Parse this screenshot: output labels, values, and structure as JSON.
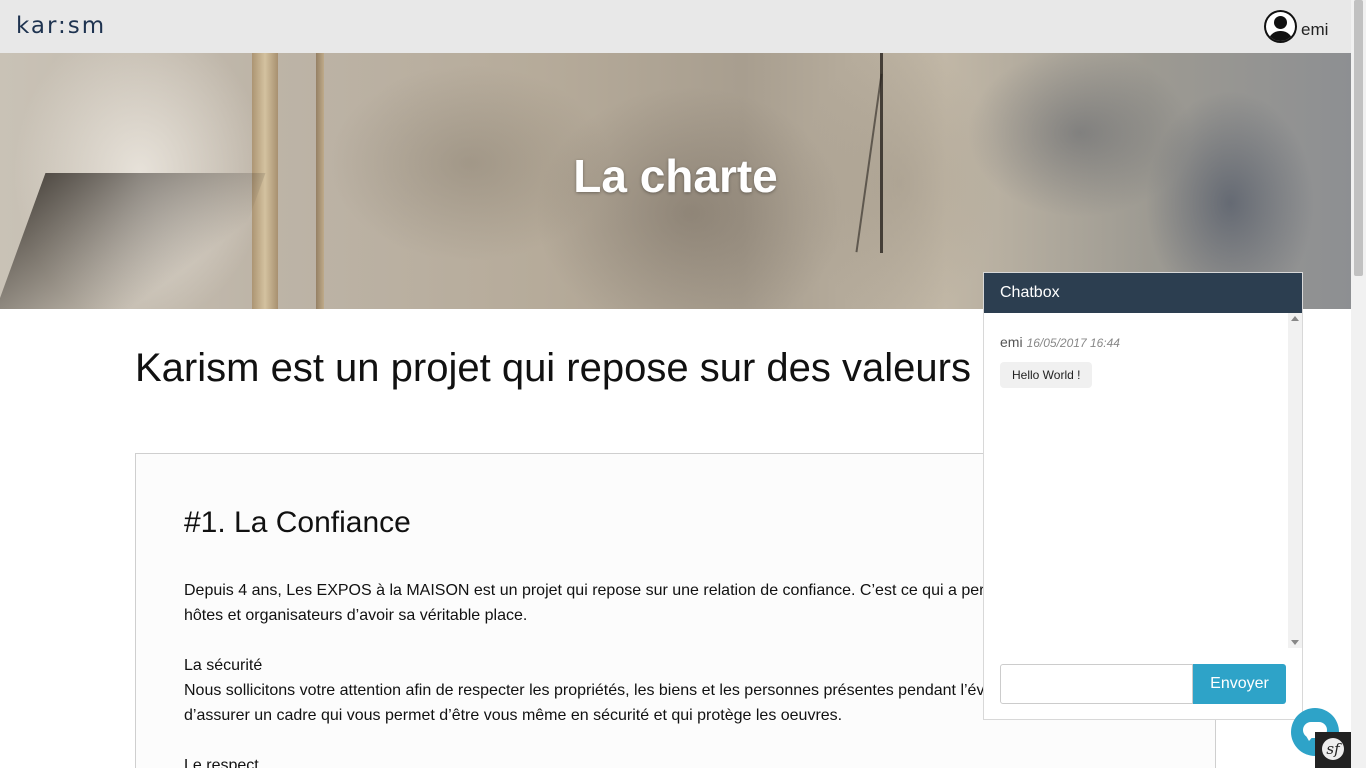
{
  "header": {
    "logo": "kar:sm",
    "user_name": "emi"
  },
  "hero": {
    "title": "La charte"
  },
  "main": {
    "heading": "Karism est un projet qui repose sur des valeurs",
    "section": {
      "title": "#1. La Confiance",
      "paragraphs": [
        "Depuis 4 ans, Les EXPOS à la MAISON est un projet qui repose sur une relation de confiance. C’est ce qui a permi",
        "hôtes et organisateurs d’avoir sa véritable place.",
        "La sécurité",
        "Nous sollicitons votre attention afin de respecter les propriétés, les biens et les personnes présentes pendant l’év",
        "d’assurer un cadre qui vous permet d’être vous même en sécurité et qui protège les oeuvres.",
        "Le respect"
      ]
    }
  },
  "chatbox": {
    "title": "Chatbox",
    "messages": [
      {
        "author": "emi",
        "time": "16/05/2017 16:44",
        "text": "Hello World !"
      }
    ],
    "input_value": "",
    "send_label": "Envoyer"
  },
  "icons": {
    "user": "user-circle-icon",
    "chat_toggle": "chat-bubble-icon",
    "symfony": "symfony-logo-icon"
  },
  "colors": {
    "topbar_bg": "#e8e8e8",
    "logo": "#1e3350",
    "chat_header_bg": "#2c3e50",
    "accent": "#2ea3c8"
  }
}
